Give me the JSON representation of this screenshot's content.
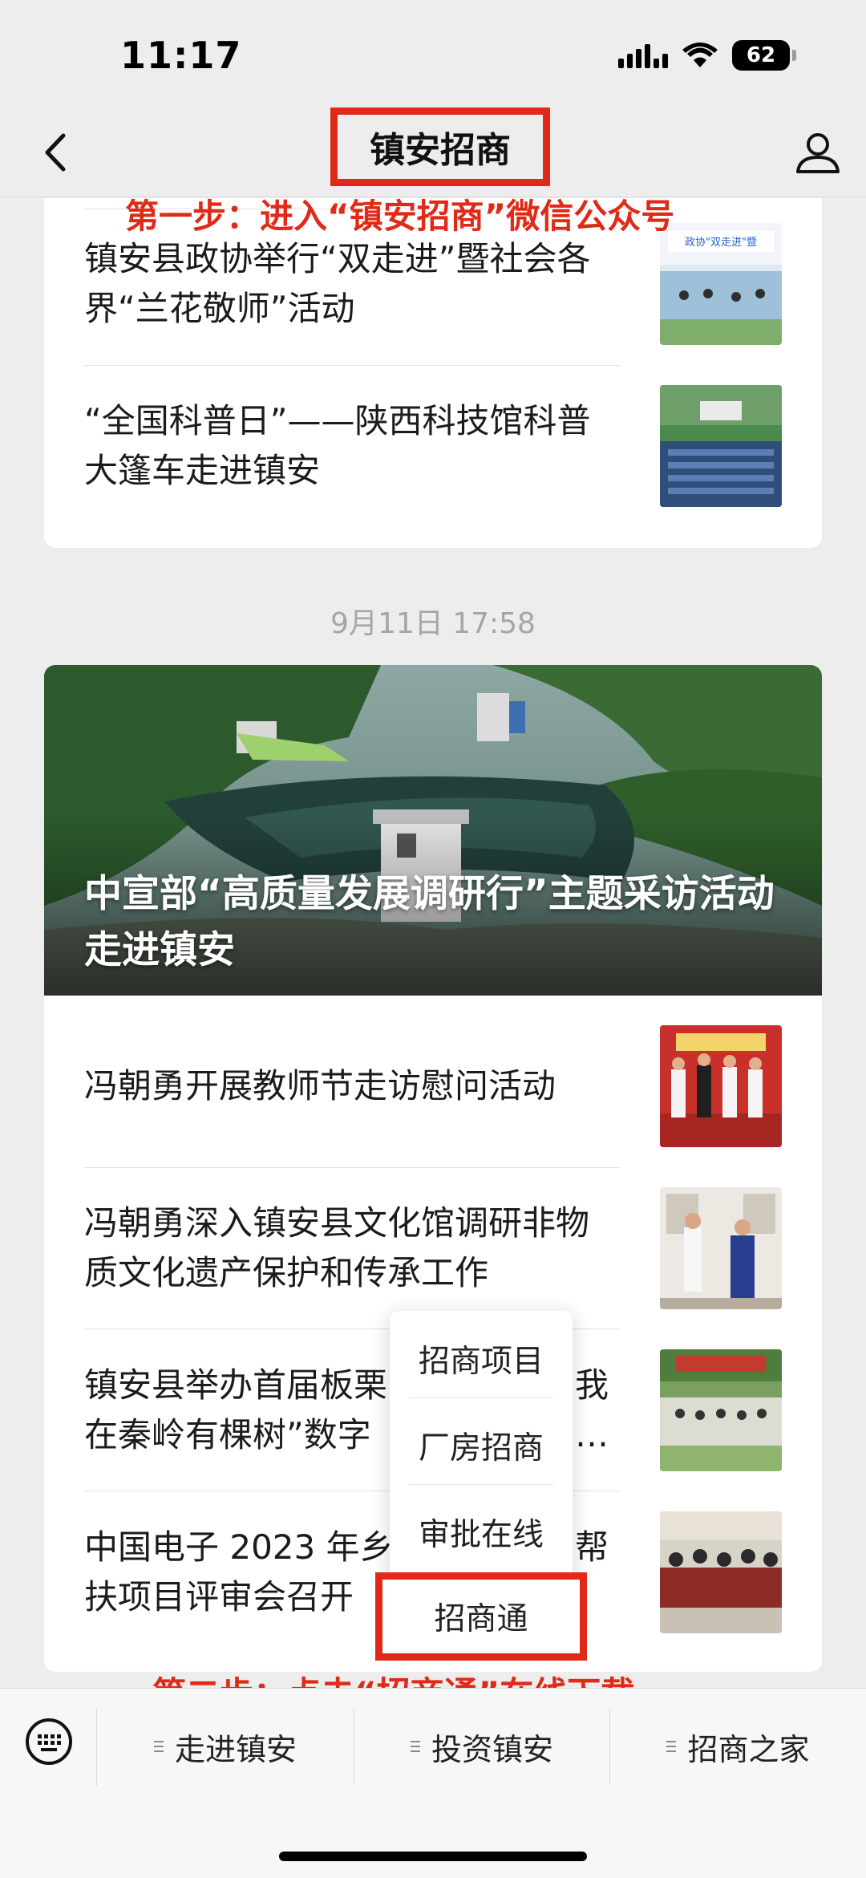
{
  "status_bar": {
    "time": "11:17",
    "battery": "62"
  },
  "nav": {
    "title": "镇安招商"
  },
  "annotations": {
    "step1": "第一步：进入“镇安招商”微信公众号",
    "step2": "第二步：点击“招商通”在线下载"
  },
  "articles_top": [
    {
      "title": "镇安县政协举行“双走进”暨社会各界“兰花敬师”活动"
    },
    {
      "title": "“全国科普日”——陕西科技馆科普大篷车走进镇安"
    }
  ],
  "timestamp": "9月11日 17:58",
  "hero": {
    "title": "中宣部“高质量发展调研行”主题采访活动走进镇安"
  },
  "articles_bottom": [
    {
      "title": "冯朝勇开展教师节走访慰问活动"
    },
    {
      "title": "冯朝勇深入镇安县文化馆调研非物质文化遗产保护和传承工作"
    },
    {
      "title_line1": "镇安县举办首届板栗",
      "title_line1_end": "我",
      "title_line2": "在秦岭有棵树”数字",
      "title_line2_end": "…"
    },
    {
      "title_line1": "中国电子 2023 年乡",
      "title_line1_end": "帮",
      "title_line2": "扶项目评审会召开"
    }
  ],
  "popup_menu": {
    "items": [
      "招商项目",
      "厂房招商",
      "审批在线"
    ],
    "highlighted": "招商通"
  },
  "bottom_menu": {
    "tabs": [
      "走进镇安",
      "投资镇安",
      "招商之家"
    ]
  },
  "colors": {
    "annotation_red": "#e02a17",
    "background": "#ededed"
  }
}
